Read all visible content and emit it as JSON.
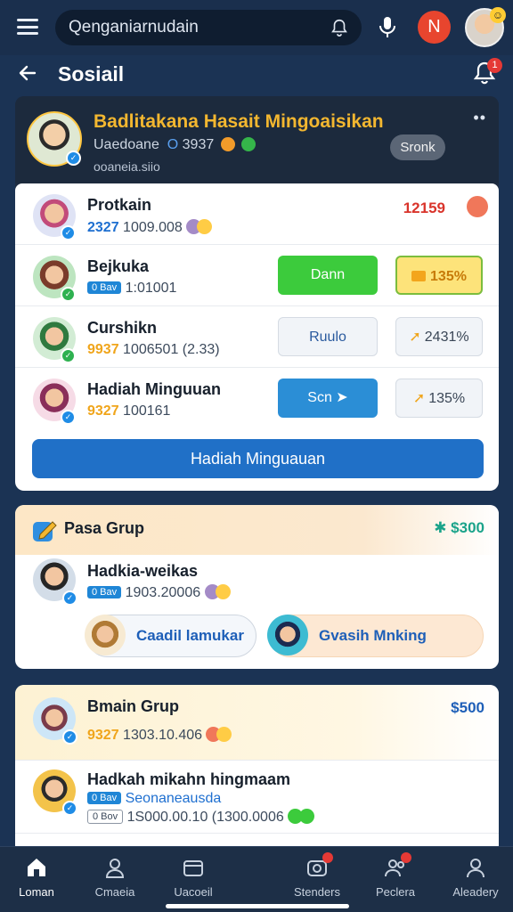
{
  "search": {
    "value": "Qenganiarnudain"
  },
  "top": {
    "badge_letter": "N"
  },
  "header": {
    "title": "Sosiail",
    "notif_count": "1"
  },
  "feature": {
    "title": "Badlitakana Hasait Mingoaisikan",
    "subtitle": "Uaedoane",
    "stat": "3937",
    "meta": "ooaneia.siio",
    "button": "Sronk",
    "rows": [
      {
        "name": "Protkain",
        "stat_a": "2327",
        "stat_b": "1009.008",
        "right": "12159"
      },
      {
        "name": "Bejkuka",
        "tag": "0 Bav",
        "stat_b": "1:01001",
        "pill_left": "Dann",
        "pill_right": "135%"
      },
      {
        "name": "Curshikn",
        "stat_a": "9937",
        "stat_b": "1006501 (2.33)",
        "pill_left": "Ruulo",
        "pill_right": "2431%"
      },
      {
        "name": "Hadiah Minguuan",
        "stat_a": "9327",
        "stat_b": "100161",
        "pill_left": "Scn",
        "pill_right": "135%"
      }
    ],
    "cta": "Hadiah Minguauan"
  },
  "group1": {
    "title": "Pasa Grup",
    "amount": "$300",
    "member": {
      "name": "Hadkia-weikas",
      "tag": "0 Bav",
      "stat": "1903.20006"
    },
    "btn_left": "Caadil lamukar",
    "btn_right": "Gvasih Mnking"
  },
  "group2": {
    "title": "Bmain Grup",
    "amount": "$500",
    "stat_a": "9327",
    "stat_b": "1303.10.406",
    "member": {
      "name": "Hadkah mikahn hingmaam",
      "tag": "0 Bav",
      "sub": "Seonaneausda",
      "tag2": "0 Bov",
      "stat": "1S000.00.10 (1300.0006"
    }
  },
  "nav": [
    {
      "label": "Loman",
      "icon": "home-icon"
    },
    {
      "label": "Cmaeia",
      "icon": "person-icon"
    },
    {
      "label": "Uacoeil",
      "icon": "wallet-icon"
    },
    {
      "label": "Stenders",
      "icon": "camera-icon"
    },
    {
      "label": "Peclera",
      "icon": "people-icon"
    },
    {
      "label": "Aleadery",
      "icon": "profile-icon"
    }
  ],
  "colors": {
    "accent": "#2070c7",
    "gold": "#f3b730",
    "bg": "#1b3354"
  }
}
